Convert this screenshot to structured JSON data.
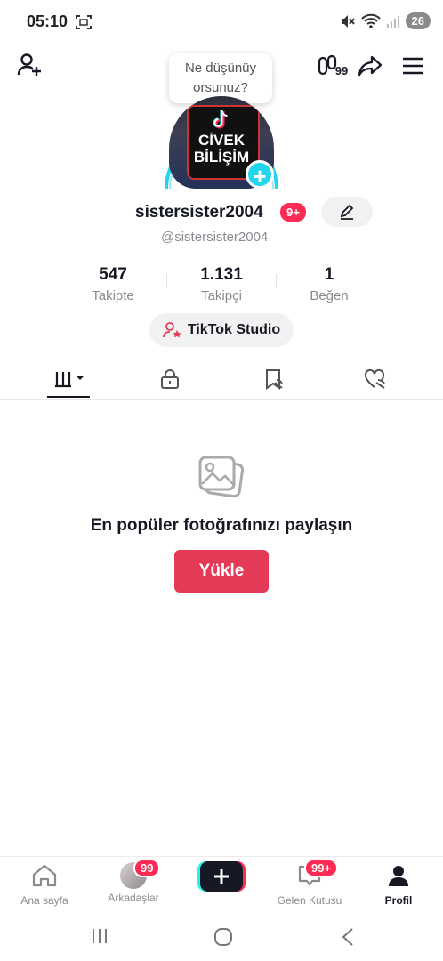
{
  "status": {
    "time": "05:10",
    "battery": "26"
  },
  "header": {
    "tooltip_line1": "Ne düşünüy",
    "tooltip_line2": "orsunuz?",
    "friends_count": "99"
  },
  "profile": {
    "avatar_text1": "CİVEK",
    "avatar_text2": "BİLİŞİM",
    "username": "sistersister2004",
    "notif_badge": "9+",
    "handle": "@sistersister2004",
    "stats": [
      {
        "value": "547",
        "label": "Takipte"
      },
      {
        "value": "1.131",
        "label": "Takipçi"
      },
      {
        "value": "1",
        "label": "Beğen"
      }
    ],
    "studio_label": "TikTok Studio"
  },
  "empty_state": {
    "title": "En popüler fotoğrafınızı paylaşın",
    "upload_label": "Yükle"
  },
  "bottom_nav": {
    "home": "Ana sayfa",
    "friends": "Arkadaşlar",
    "friends_badge": "99",
    "inbox": "Gelen Kutusu",
    "inbox_badge": "99+",
    "profile": "Profil"
  },
  "colors": {
    "accent": "#fe2c55",
    "upload": "#e53a57",
    "ring": "#20d5ec"
  }
}
